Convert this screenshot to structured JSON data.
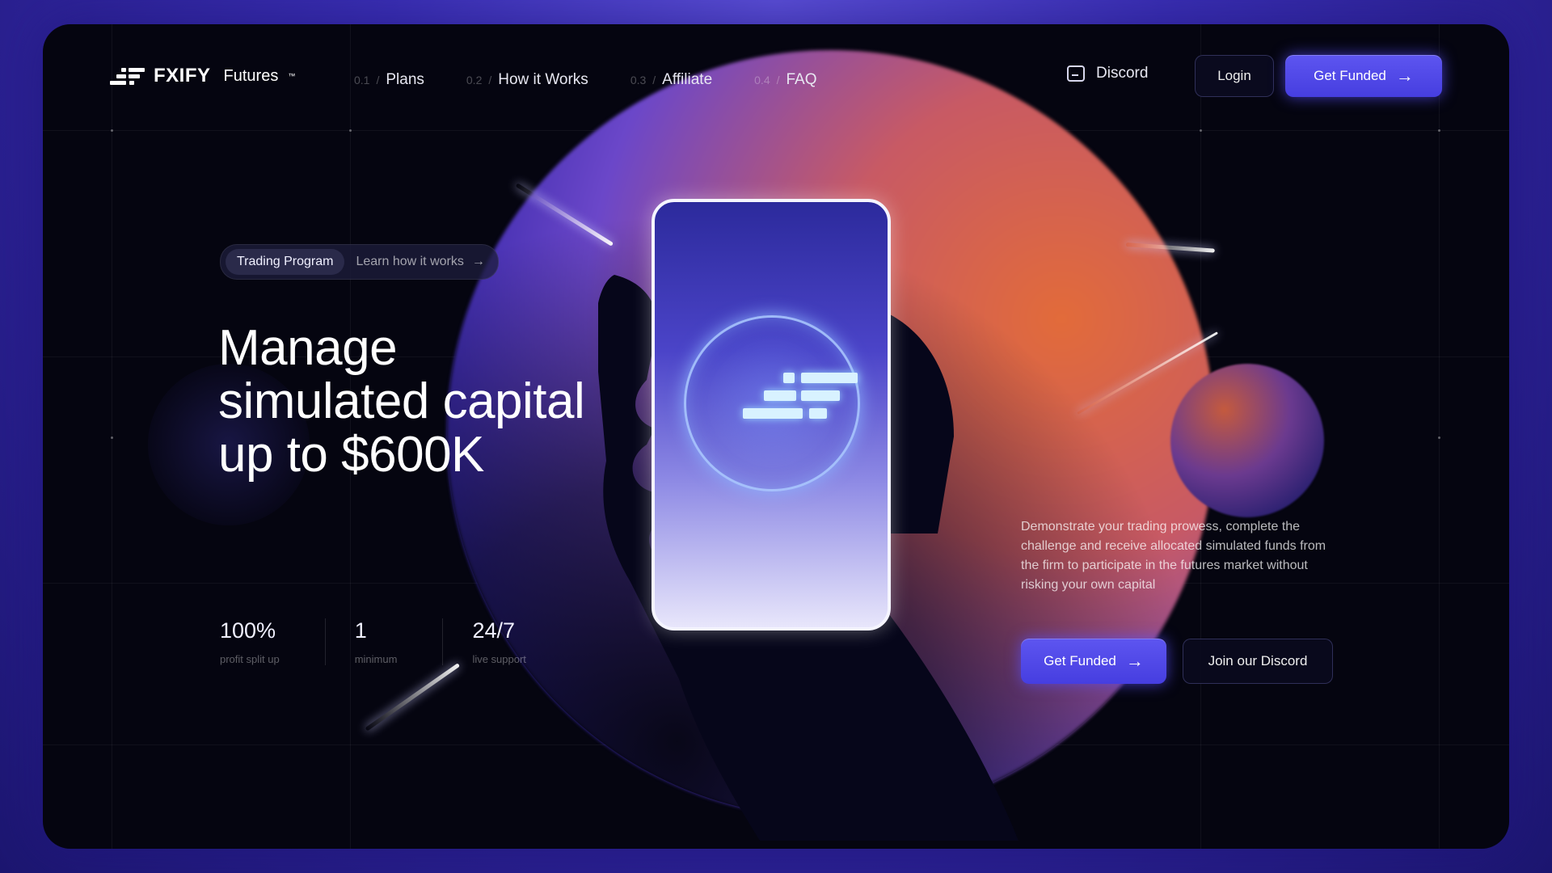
{
  "brand": {
    "name": "FXIFY",
    "product": "Futures",
    "tm": "™"
  },
  "nav": [
    {
      "num": "0.1",
      "label": "Plans"
    },
    {
      "num": "0.2",
      "label": "How it Works"
    },
    {
      "num": "0.3",
      "label": "Affiliate"
    },
    {
      "num": "0.4",
      "label": "FAQ"
    }
  ],
  "header": {
    "discord_label": "Discord",
    "login_label": "Login",
    "get_funded_label": "Get Funded"
  },
  "hero": {
    "pill_tag": "Trading Program",
    "pill_link": "Learn how it works",
    "headline": [
      "Manage",
      "simulated capital",
      "up to $600K"
    ],
    "description": "Demonstrate your trading prowess, complete the challenge and receive allocated simulated funds from the firm to participate in the futures market without risking your own capital",
    "cta_primary": "Get Funded",
    "cta_secondary": "Join our Discord"
  },
  "stats": [
    {
      "value": "100%",
      "label": "profit split up"
    },
    {
      "value": "1",
      "label": "minimum"
    },
    {
      "value": "24/7",
      "label": "live support"
    }
  ],
  "icons": {
    "arrow": "arrow-right-icon",
    "discord": "discord-icon",
    "logo": "fxify-logo-icon"
  },
  "colors": {
    "accent": "#4f46e5",
    "frame_bg": "#050510",
    "orb_orange": "#e26b3a",
    "orb_purple": "#6b47c9"
  }
}
